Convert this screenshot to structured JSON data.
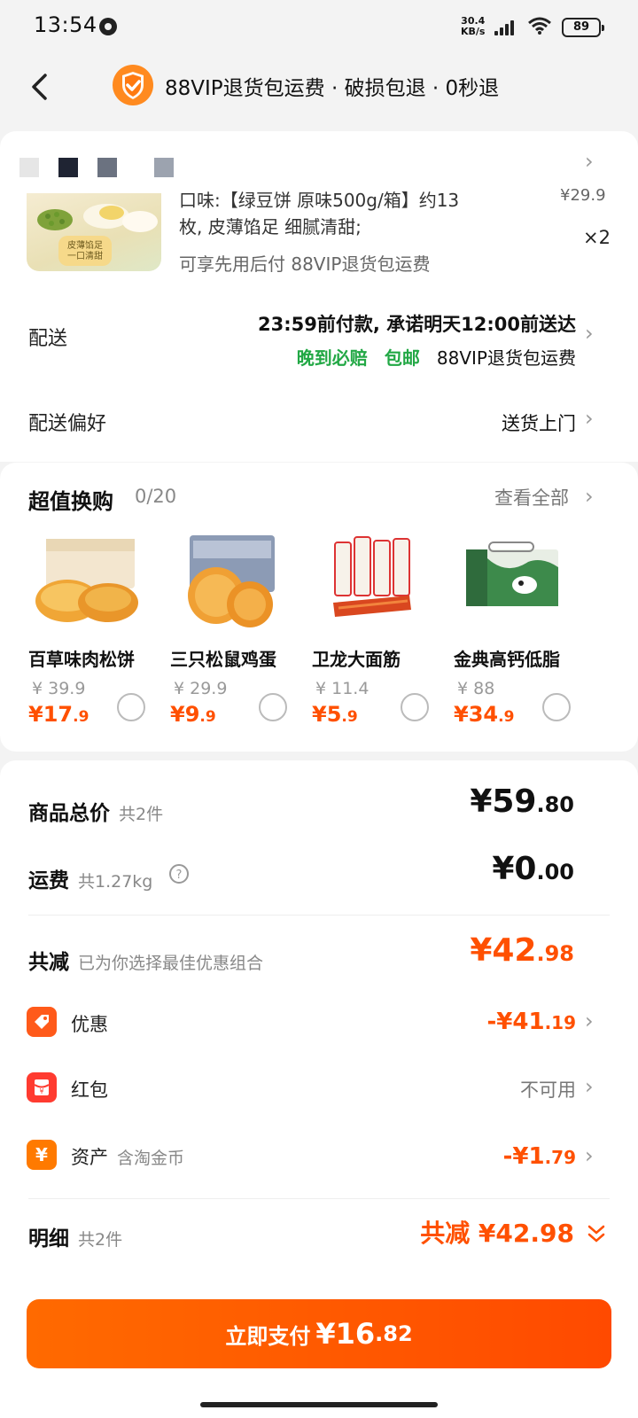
{
  "status": {
    "time": "13:54",
    "speed_top": "30.4",
    "speed_bottom": "KB/s",
    "network": "5G",
    "battery": "89"
  },
  "header": {
    "title": "88VIP退货包运费 · 破损包退 · 0秒退"
  },
  "product": {
    "desc_line1": "口味:【绿豆饼 原味500g/箱】约13",
    "desc_line2": "枚, 皮薄馅足 细腻清甜;",
    "benefit": "可享先用后付  88VIP退货包运费",
    "price_partial": "¥29.9",
    "qty": "×2",
    "img_tag": "皮薄馅足 一口清甜"
  },
  "delivery": {
    "label": "配送",
    "line1": "23:59前付款, 承诺明天12:00前送达",
    "late_comp": "晚到必赔",
    "free_ship": "包邮",
    "vip": "88VIP退货包运费"
  },
  "pref": {
    "label": "配送偏好",
    "value": "送货上门"
  },
  "swap": {
    "title": "超值换购",
    "count": "0/20",
    "see_all": "查看全部",
    "items": [
      {
        "name": "百草味肉松饼",
        "orig": "¥ 39.9",
        "sale_int": "¥17",
        "sale_dec": ".9"
      },
      {
        "name": "三只松鼠鸡蛋",
        "orig": "¥ 29.9",
        "sale_int": "¥9",
        "sale_dec": ".9"
      },
      {
        "name": "卫龙大面筋",
        "orig": "¥ 11.4",
        "sale_int": "¥5",
        "sale_dec": ".9"
      },
      {
        "name": "金典高钙低脂",
        "orig": "¥ 88",
        "sale_int": "¥34",
        "sale_dec": ".9"
      }
    ]
  },
  "summary": {
    "total_label": "商品总价",
    "total_sub": "共2件",
    "total_int": "¥59",
    "total_dec": ".80",
    "ship_label": "运费",
    "ship_sub": "共1.27kg",
    "ship_int": "¥0",
    "ship_dec": ".00",
    "reduce_label": "共减",
    "reduce_sub": "已为你选择最佳优惠组合",
    "reduce_int": "¥42",
    "reduce_dec": ".98",
    "discount_label": "优惠",
    "discount_int": "-¥41",
    "discount_dec": ".19",
    "redpacket_label": "红包",
    "redpacket_value": "不可用",
    "asset_label": "资产",
    "asset_sub": "含淘金币",
    "asset_int": "-¥1",
    "asset_dec": ".79",
    "detail_label": "明细",
    "detail_sub": "共2件",
    "detail_value": "共减 ¥42.98"
  },
  "pay": {
    "label": "立即支付",
    "int": "¥16",
    "dec": ".82"
  },
  "colors": {
    "accent": "#ff5000",
    "green": "#22a845"
  }
}
